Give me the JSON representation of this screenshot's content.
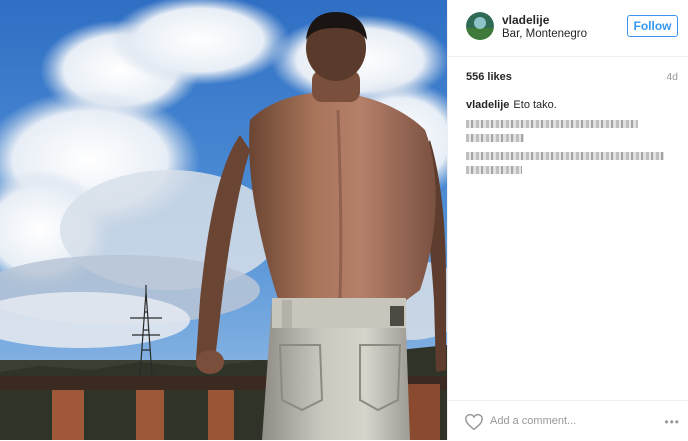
{
  "post": {
    "image_alt": "Eto tako.",
    "username": "vladelije",
    "location": "Bar, Montenegro",
    "follow_label": "Follow",
    "likes": "556 likes",
    "age": "4d",
    "caption_user": "vladelije",
    "caption_text": "Eto tako.",
    "add_comment_placeholder": "Add a comment...",
    "more_label": "•••"
  },
  "icons": {
    "like": "heart-icon",
    "more": "more-options-icon"
  },
  "colors": {
    "accent": "#3897f0",
    "text": "#262626",
    "muted": "#999999",
    "divider": "#efefef"
  }
}
